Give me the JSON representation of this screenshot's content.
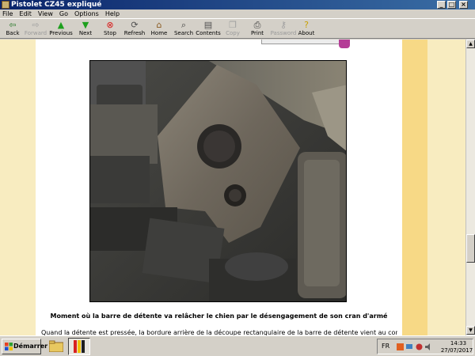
{
  "window": {
    "title": "Pistolet CZ45 expliqué",
    "minimize_glyph": "_",
    "maximize_glyph": "□",
    "close_glyph": "×"
  },
  "menubar": {
    "items": [
      "File",
      "Edit",
      "View",
      "Go",
      "Options",
      "Help"
    ]
  },
  "toolbar": {
    "buttons": [
      {
        "label": "Back",
        "icon": "back-arrow-icon",
        "enabled": true
      },
      {
        "label": "Forward",
        "icon": "forward-arrow-icon",
        "enabled": false
      },
      {
        "label": "Previous",
        "icon": "previous-arrow-icon",
        "enabled": true
      },
      {
        "label": "Next",
        "icon": "next-arrow-icon",
        "enabled": true
      },
      {
        "label": "Stop",
        "icon": "stop-icon",
        "enabled": true
      },
      {
        "label": "Refresh",
        "icon": "refresh-icon",
        "enabled": true
      },
      {
        "label": "Home",
        "icon": "home-icon",
        "enabled": true
      },
      {
        "label": "Search",
        "icon": "search-icon",
        "enabled": true
      },
      {
        "label": "Contents",
        "icon": "contents-icon",
        "enabled": true
      },
      {
        "label": "Copy",
        "icon": "copy-icon",
        "enabled": false
      },
      {
        "label": "Print",
        "icon": "print-icon",
        "enabled": true
      },
      {
        "label": "Password",
        "icon": "password-key-icon",
        "enabled": false
      },
      {
        "label": "About",
        "icon": "about-icon",
        "enabled": true
      }
    ]
  },
  "content": {
    "caption": "Moment où la barre de détente va relâcher le chien par le désengagement de son cran d'armé",
    "paragraph": "Quand la détente est pressée, la bordure arrière de la découpe rectangulaire de la barre de détente vient au contact du"
  },
  "taskbar": {
    "start_label": "Démarrer",
    "language": "FR",
    "time": "14:33",
    "date": "27/07/2017"
  },
  "colors": {
    "titlebar_start": "#0a246a",
    "titlebar_end": "#3a6ea5",
    "page_band_light": "#f8ecc0",
    "page_band_gold": "#f7d986",
    "accent_pink": "#b43c96"
  }
}
